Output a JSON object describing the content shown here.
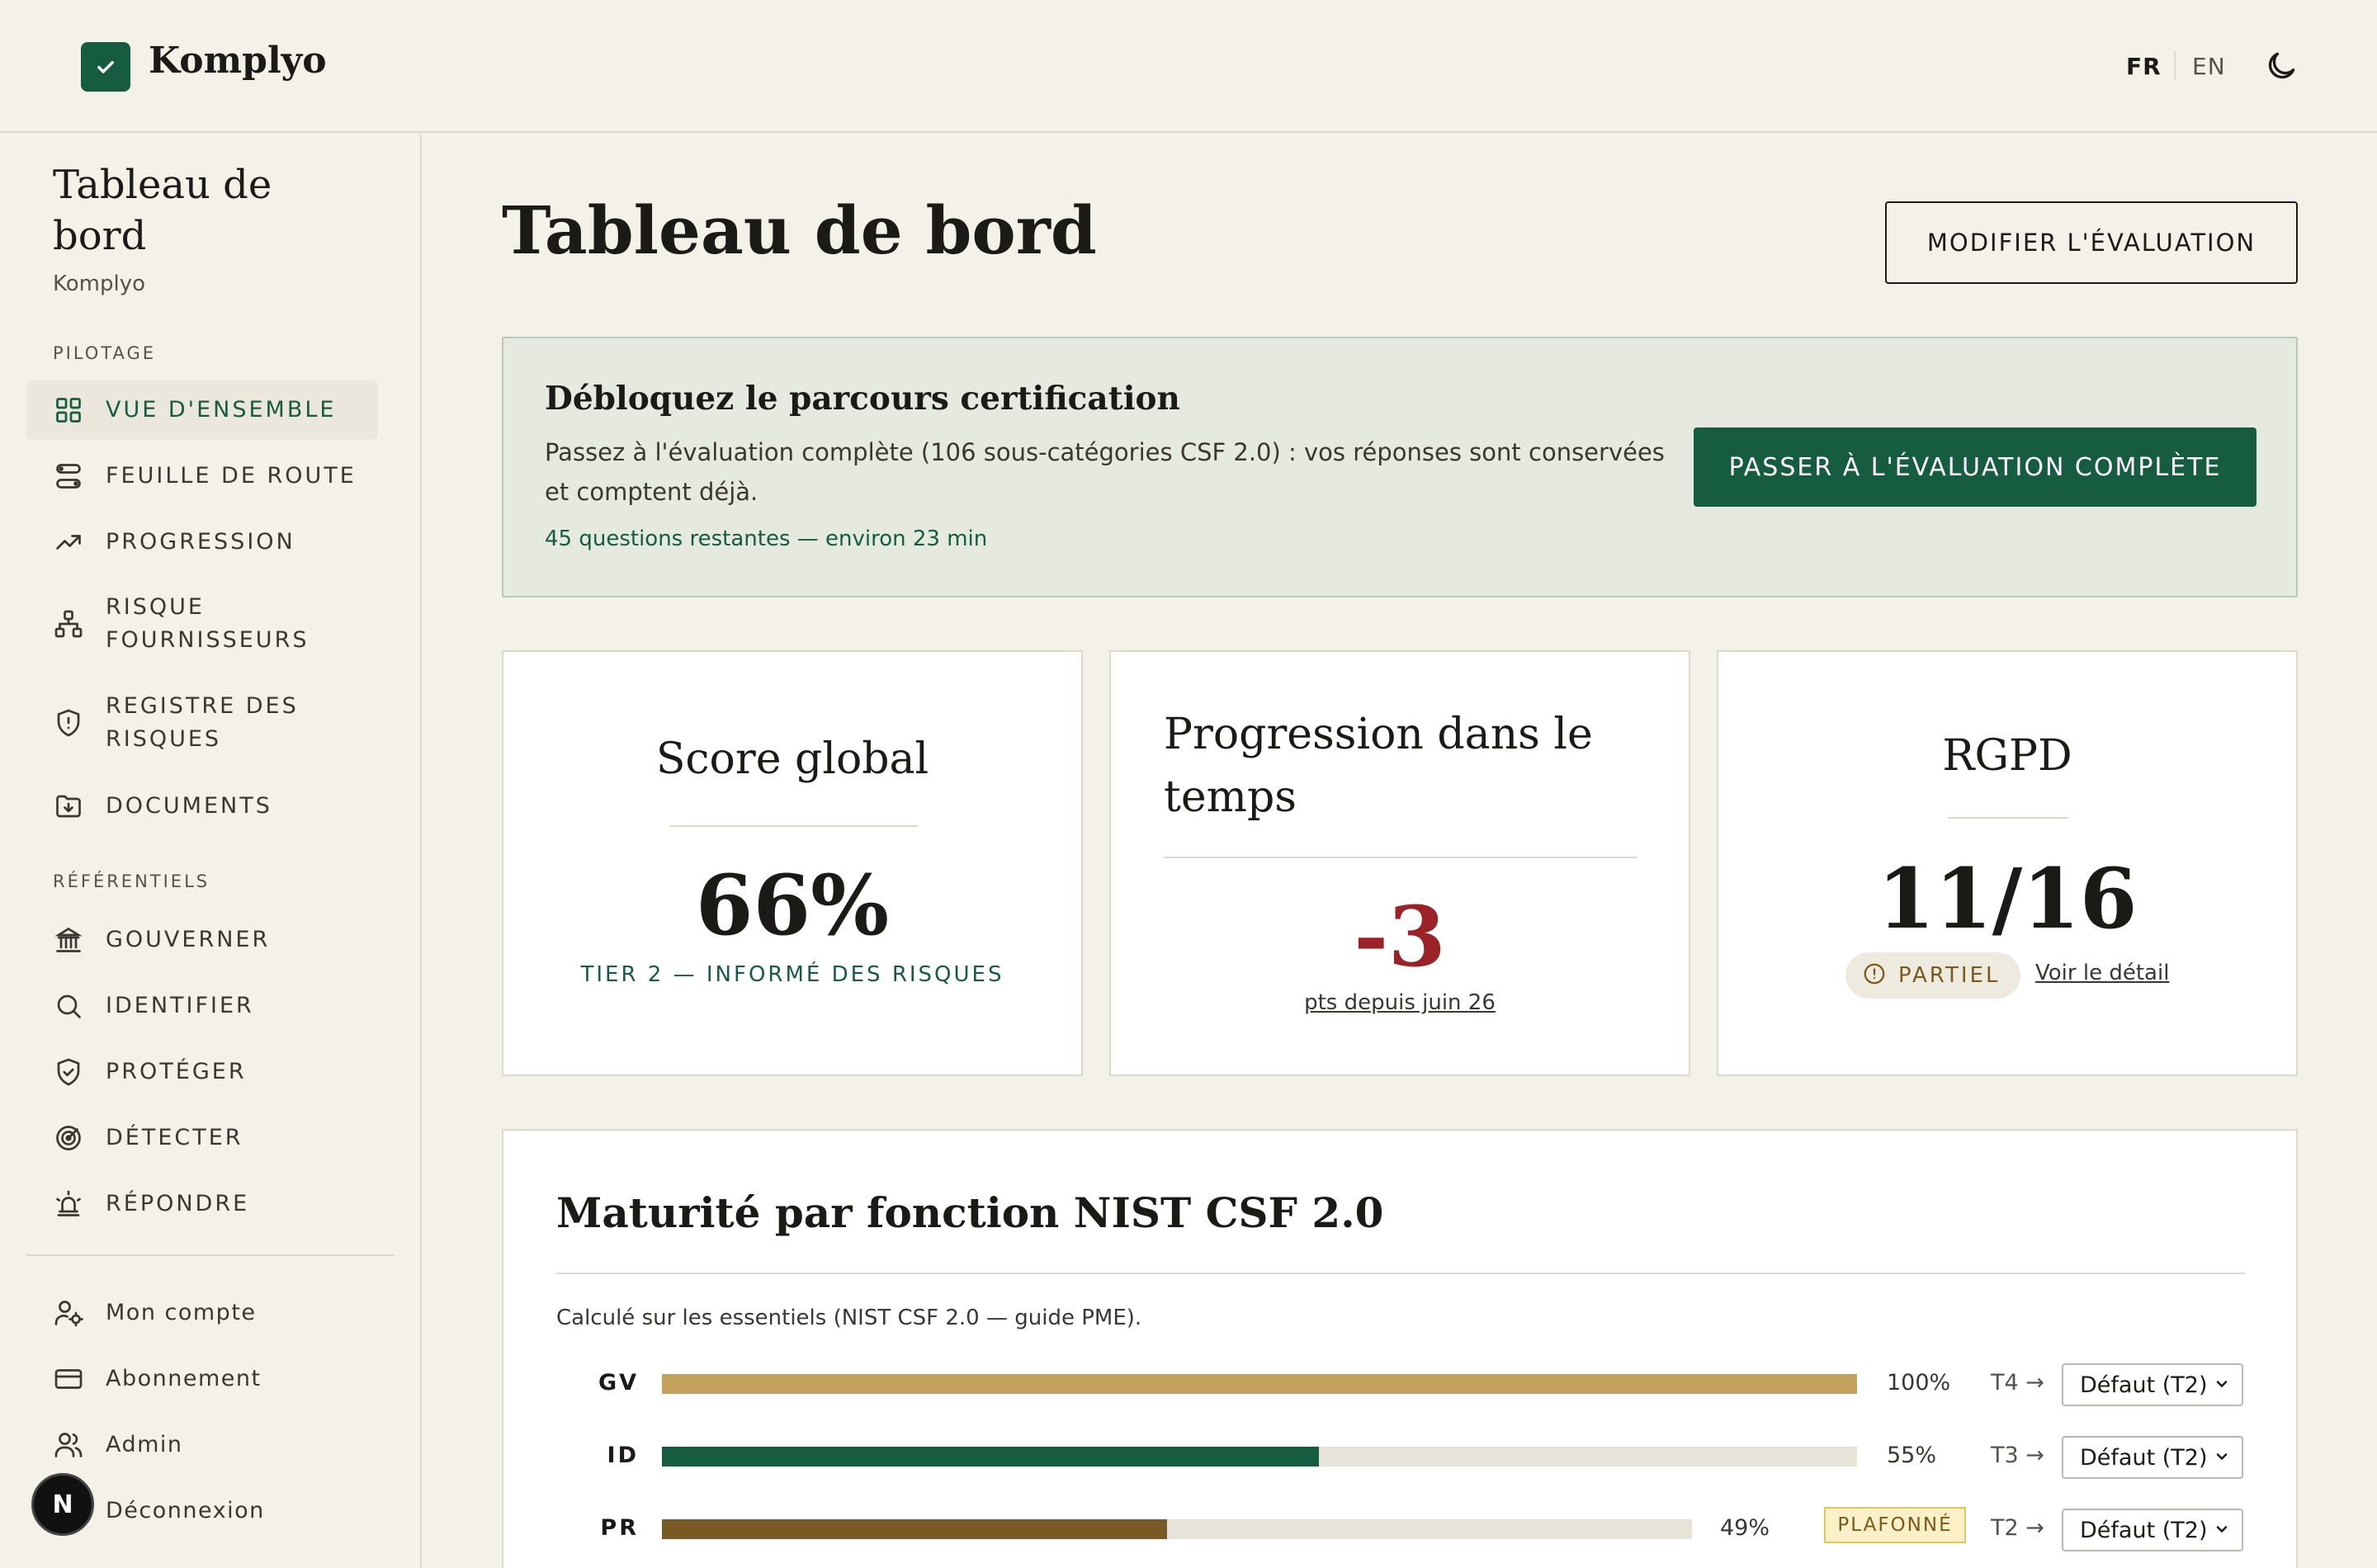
{
  "brand": {
    "name": "Komplyo"
  },
  "header": {
    "lang_fr": "FR",
    "lang_en": "EN"
  },
  "sidebar": {
    "title": "Tableau de bord",
    "subtitle": "Komplyo",
    "section_pilotage": "PILOTAGE",
    "section_referentiels": "RÉFÉRENTIELS",
    "items": [
      {
        "label": "VUE D'ENSEMBLE",
        "icon": "grid-icon",
        "active": true
      },
      {
        "label": "FEUILLE DE ROUTE",
        "icon": "route-icon"
      },
      {
        "label": "PROGRESSION",
        "icon": "trending-up-icon"
      },
      {
        "label": "RISQUE FOURNISSEURS",
        "icon": "network-icon"
      },
      {
        "label": "REGISTRE DES RISQUES",
        "icon": "shield-alert-icon"
      },
      {
        "label": "DOCUMENTS",
        "icon": "folder-download-icon"
      }
    ],
    "ref_items": [
      {
        "label": "GOUVERNER",
        "icon": "landmark-icon"
      },
      {
        "label": "IDENTIFIER",
        "icon": "search-icon"
      },
      {
        "label": "PROTÉGER",
        "icon": "shield-check-icon"
      },
      {
        "label": "DÉTECTER",
        "icon": "radar-icon"
      },
      {
        "label": "RÉPONDRE",
        "icon": "siren-icon"
      }
    ],
    "account_items": [
      {
        "label": "Mon compte",
        "icon": "user-cog-icon"
      },
      {
        "label": "Abonnement",
        "icon": "credit-card-icon"
      },
      {
        "label": "Admin",
        "icon": "users-icon"
      },
      {
        "label": "Déconnexion",
        "icon": "logout-icon"
      }
    ],
    "fab_letter": "N"
  },
  "main": {
    "title": "Tableau de bord",
    "edit_button": "MODIFIER L'ÉVALUATION",
    "banner": {
      "title": "Débloquez le parcours certification",
      "text": "Passez à l'évaluation complète (106 sous-catégories CSF 2.0) : vos réponses sont conservées et comptent déjà.",
      "note": "45 questions restantes — environ 23 min",
      "button": "PASSER À L'ÉVALUATION COMPLÈTE"
    },
    "cards": {
      "score": {
        "title": "Score global",
        "value": "66%",
        "tier": "TIER 2 — INFORMÉ DES RISQUES"
      },
      "progress": {
        "title": "Progression dans le temps",
        "value": "-3",
        "link": "pts depuis juin 26"
      },
      "rgpd": {
        "title": "RGPD",
        "value": "11/16",
        "badge": "PARTIEL",
        "link": "Voir le détail"
      }
    },
    "maturity": {
      "title": "Maturité par fonction NIST CSF 2.0",
      "description": "Calculé sur les essentiels (NIST CSF 2.0 — guide PME).",
      "rows": [
        {
          "code": "GV",
          "value": 1.0,
          "pct": "100%",
          "tier": "T4 →",
          "select": "Défaut (T2)",
          "color": "#c4a25e"
        },
        {
          "code": "ID",
          "value": 0.55,
          "pct": "55%",
          "tier": "T3 →",
          "select": "Défaut (T2)",
          "color": "#155c40"
        },
        {
          "code": "PR",
          "value": 0.49,
          "pct": "49%",
          "tier": "T2 →",
          "select": "Défaut (T2)",
          "color": "#7a5a24",
          "badge": "PLAFONNÉ"
        }
      ]
    }
  },
  "colors": {
    "brand_green": "#155c40",
    "negative": "#9b2226",
    "gold": "#c4a25e"
  }
}
